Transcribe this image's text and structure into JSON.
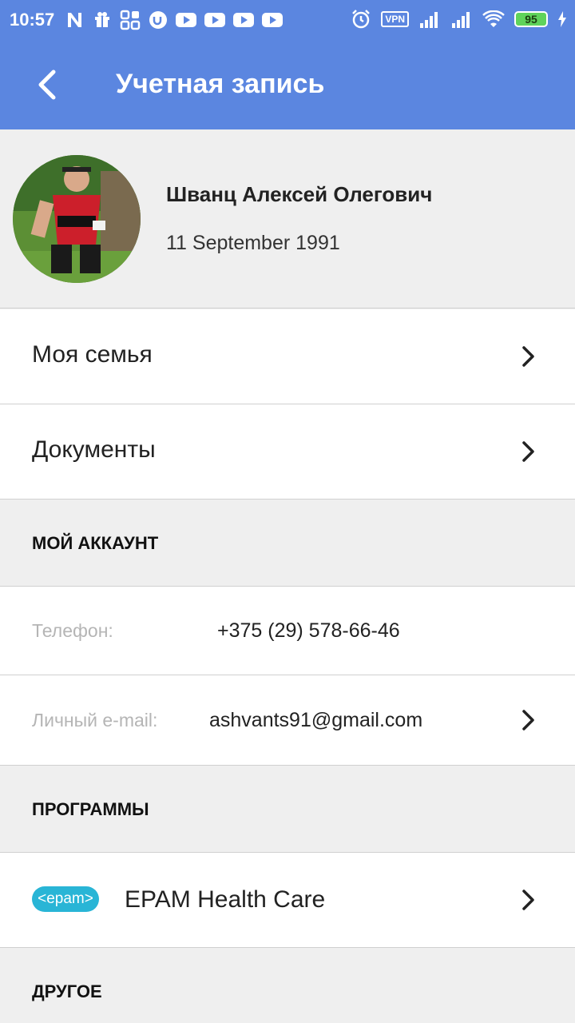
{
  "status_bar": {
    "time": "10:57",
    "left_icons": [
      "n-icon",
      "gift-icon",
      "apps-icon",
      "u-app-icon",
      "youtube-icon",
      "youtube-icon",
      "youtube-icon",
      "youtube-icon"
    ],
    "vpn": "VPN",
    "battery": "95"
  },
  "appbar": {
    "title": "Учетная запись",
    "color": "#5b86e0"
  },
  "profile": {
    "name": "Шванц Алексей Олегович",
    "dob": "11 September 1991"
  },
  "menu": [
    {
      "label": "Моя семья"
    },
    {
      "label": "Документы"
    }
  ],
  "sections": {
    "account": "МОЙ АККАУНТ",
    "programs": "ПРОГРАММЫ",
    "other": "ДРУГОЕ"
  },
  "account": {
    "phone_label": "Телефон:",
    "phone_value": "+375 (29) 578-66-46",
    "email_label": "Личный e-mail:",
    "email_value": "ashvants91@gmail.com"
  },
  "programs": {
    "badge": "<epam>",
    "name": "EPAM Health Care"
  }
}
